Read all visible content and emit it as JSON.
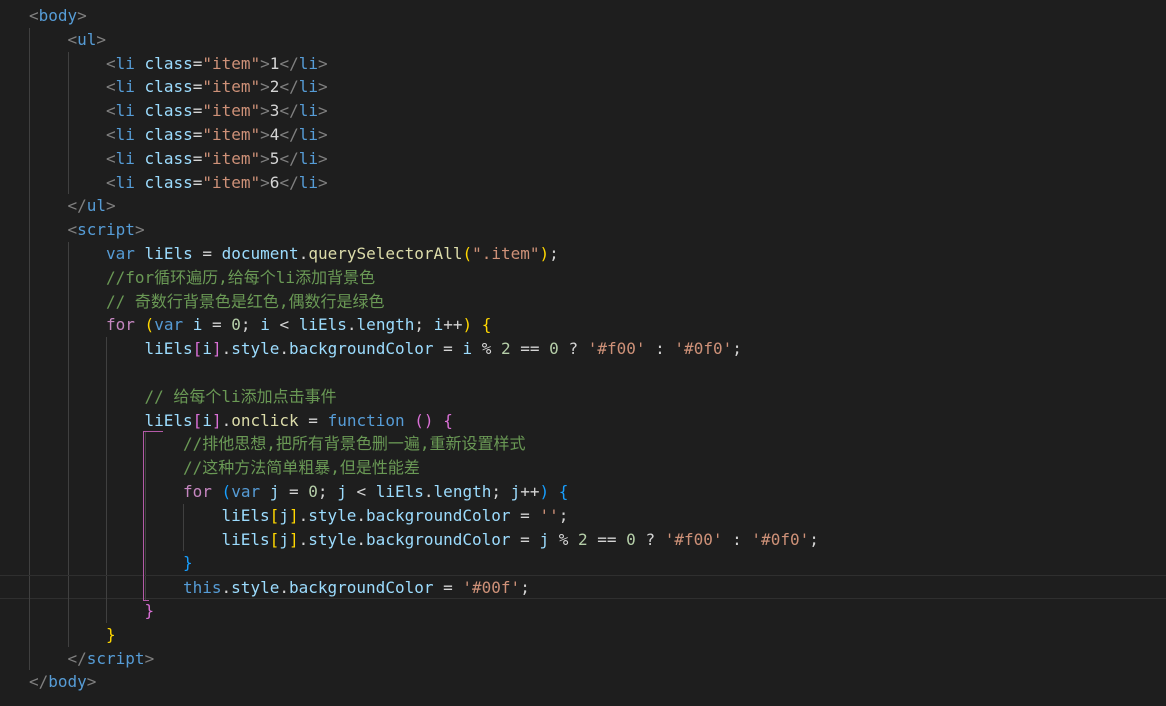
{
  "theme": {
    "background": "#1e1e1e",
    "colors": {
      "punct": "#808080",
      "tag": "#569cd6",
      "attr": "#9cdcfe",
      "string": "#ce9178",
      "text": "#d4d4d4",
      "keyword": "#569cd6",
      "control": "#c586c0",
      "variable": "#9cdcfe",
      "method": "#dcdcaa",
      "comment": "#6a9955",
      "number": "#b5cea8",
      "operator": "#d4d4d4",
      "bracket1": "#ffd700",
      "bracket2": "#da70d6",
      "bracket3": "#179fff"
    }
  },
  "code": {
    "current_line": 24,
    "lines": [
      {
        "indent": 0,
        "tokens": [
          [
            "<",
            "punct"
          ],
          [
            "body",
            "tag"
          ],
          [
            ">",
            "punct"
          ]
        ]
      },
      {
        "indent": 1,
        "tokens": [
          [
            "<",
            "punct"
          ],
          [
            "ul",
            "tag"
          ],
          [
            ">",
            "punct"
          ]
        ]
      },
      {
        "indent": 2,
        "tokens": [
          [
            "<",
            "punct"
          ],
          [
            "li",
            "tag"
          ],
          [
            " ",
            "text"
          ],
          [
            "class",
            "attr"
          ],
          [
            "=",
            "text"
          ],
          [
            "\"item\"",
            "string"
          ],
          [
            ">",
            "punct"
          ],
          [
            "1",
            "text"
          ],
          [
            "</",
            "punct"
          ],
          [
            "li",
            "tag"
          ],
          [
            ">",
            "punct"
          ]
        ]
      },
      {
        "indent": 2,
        "tokens": [
          [
            "<",
            "punct"
          ],
          [
            "li",
            "tag"
          ],
          [
            " ",
            "text"
          ],
          [
            "class",
            "attr"
          ],
          [
            "=",
            "text"
          ],
          [
            "\"item\"",
            "string"
          ],
          [
            ">",
            "punct"
          ],
          [
            "2",
            "text"
          ],
          [
            "</",
            "punct"
          ],
          [
            "li",
            "tag"
          ],
          [
            ">",
            "punct"
          ]
        ]
      },
      {
        "indent": 2,
        "tokens": [
          [
            "<",
            "punct"
          ],
          [
            "li",
            "tag"
          ],
          [
            " ",
            "text"
          ],
          [
            "class",
            "attr"
          ],
          [
            "=",
            "text"
          ],
          [
            "\"item\"",
            "string"
          ],
          [
            ">",
            "punct"
          ],
          [
            "3",
            "text"
          ],
          [
            "</",
            "punct"
          ],
          [
            "li",
            "tag"
          ],
          [
            ">",
            "punct"
          ]
        ]
      },
      {
        "indent": 2,
        "tokens": [
          [
            "<",
            "punct"
          ],
          [
            "li",
            "tag"
          ],
          [
            " ",
            "text"
          ],
          [
            "class",
            "attr"
          ],
          [
            "=",
            "text"
          ],
          [
            "\"item\"",
            "string"
          ],
          [
            ">",
            "punct"
          ],
          [
            "4",
            "text"
          ],
          [
            "</",
            "punct"
          ],
          [
            "li",
            "tag"
          ],
          [
            ">",
            "punct"
          ]
        ]
      },
      {
        "indent": 2,
        "tokens": [
          [
            "<",
            "punct"
          ],
          [
            "li",
            "tag"
          ],
          [
            " ",
            "text"
          ],
          [
            "class",
            "attr"
          ],
          [
            "=",
            "text"
          ],
          [
            "\"item\"",
            "string"
          ],
          [
            ">",
            "punct"
          ],
          [
            "5",
            "text"
          ],
          [
            "</",
            "punct"
          ],
          [
            "li",
            "tag"
          ],
          [
            ">",
            "punct"
          ]
        ]
      },
      {
        "indent": 2,
        "tokens": [
          [
            "<",
            "punct"
          ],
          [
            "li",
            "tag"
          ],
          [
            " ",
            "text"
          ],
          [
            "class",
            "attr"
          ],
          [
            "=",
            "text"
          ],
          [
            "\"item\"",
            "string"
          ],
          [
            ">",
            "punct"
          ],
          [
            "6",
            "text"
          ],
          [
            "</",
            "punct"
          ],
          [
            "li",
            "tag"
          ],
          [
            ">",
            "punct"
          ]
        ]
      },
      {
        "indent": 1,
        "tokens": [
          [
            "</",
            "punct"
          ],
          [
            "ul",
            "tag"
          ],
          [
            ">",
            "punct"
          ]
        ]
      },
      {
        "indent": 1,
        "tokens": [
          [
            "<",
            "punct"
          ],
          [
            "script",
            "tag"
          ],
          [
            ">",
            "punct"
          ]
        ]
      },
      {
        "indent": 2,
        "tokens": [
          [
            "var",
            "keyword"
          ],
          [
            " ",
            "text"
          ],
          [
            "liEls",
            "variable"
          ],
          [
            " = ",
            "operator"
          ],
          [
            "document",
            "variable"
          ],
          [
            ".",
            "text"
          ],
          [
            "querySelectorAll",
            "method"
          ],
          [
            "(",
            "bracket1"
          ],
          [
            "\".item\"",
            "string"
          ],
          [
            ")",
            "bracket1"
          ],
          [
            ";",
            "text"
          ]
        ]
      },
      {
        "indent": 2,
        "tokens": [
          [
            "//for循环遍历,给每个li添加背景色",
            "comment"
          ]
        ]
      },
      {
        "indent": 2,
        "tokens": [
          [
            "// 奇数行背景色是红色,偶数行是绿色",
            "comment"
          ]
        ]
      },
      {
        "indent": 2,
        "tokens": [
          [
            "for",
            "control"
          ],
          [
            " ",
            "text"
          ],
          [
            "(",
            "bracket1"
          ],
          [
            "var",
            "keyword"
          ],
          [
            " ",
            "text"
          ],
          [
            "i",
            "variable"
          ],
          [
            " = ",
            "operator"
          ],
          [
            "0",
            "number"
          ],
          [
            "; ",
            "text"
          ],
          [
            "i",
            "variable"
          ],
          [
            " < ",
            "operator"
          ],
          [
            "liEls",
            "variable"
          ],
          [
            ".",
            "text"
          ],
          [
            "length",
            "variable"
          ],
          [
            "; ",
            "text"
          ],
          [
            "i",
            "variable"
          ],
          [
            "++",
            "operator"
          ],
          [
            ")",
            "bracket1"
          ],
          [
            " ",
            "text"
          ],
          [
            "{",
            "bracket1"
          ]
        ]
      },
      {
        "indent": 3,
        "tokens": [
          [
            "liEls",
            "variable"
          ],
          [
            "[",
            "bracket2"
          ],
          [
            "i",
            "variable"
          ],
          [
            "]",
            "bracket2"
          ],
          [
            ".",
            "text"
          ],
          [
            "style",
            "variable"
          ],
          [
            ".",
            "text"
          ],
          [
            "backgroundColor",
            "variable"
          ],
          [
            " = ",
            "operator"
          ],
          [
            "i",
            "variable"
          ],
          [
            " % ",
            "operator"
          ],
          [
            "2",
            "number"
          ],
          [
            " == ",
            "operator"
          ],
          [
            "0",
            "number"
          ],
          [
            " ? ",
            "operator"
          ],
          [
            "'#f00'",
            "string"
          ],
          [
            " : ",
            "operator"
          ],
          [
            "'#0f0'",
            "string"
          ],
          [
            ";",
            "text"
          ]
        ]
      },
      {
        "indent": 3,
        "tokens": []
      },
      {
        "indent": 3,
        "tokens": [
          [
            "// 给每个li添加点击事件",
            "comment"
          ]
        ]
      },
      {
        "indent": 3,
        "tokens": [
          [
            "liEls",
            "variable"
          ],
          [
            "[",
            "bracket2"
          ],
          [
            "i",
            "variable"
          ],
          [
            "]",
            "bracket2"
          ],
          [
            ".",
            "text"
          ],
          [
            "onclick",
            "method"
          ],
          [
            " = ",
            "operator"
          ],
          [
            "function",
            "keyword"
          ],
          [
            " ",
            "text"
          ],
          [
            "()",
            "bracket2"
          ],
          [
            " ",
            "text"
          ],
          [
            "{",
            "bracket2"
          ]
        ]
      },
      {
        "indent": 4,
        "tokens": [
          [
            "//排他思想,把所有背景色删一遍,重新设置样式",
            "comment"
          ]
        ]
      },
      {
        "indent": 4,
        "tokens": [
          [
            "//这种方法简单粗暴,但是性能差",
            "comment"
          ]
        ]
      },
      {
        "indent": 4,
        "tokens": [
          [
            "for",
            "control"
          ],
          [
            " ",
            "text"
          ],
          [
            "(",
            "bracket3"
          ],
          [
            "var",
            "keyword"
          ],
          [
            " ",
            "text"
          ],
          [
            "j",
            "variable"
          ],
          [
            " = ",
            "operator"
          ],
          [
            "0",
            "number"
          ],
          [
            "; ",
            "text"
          ],
          [
            "j",
            "variable"
          ],
          [
            " < ",
            "operator"
          ],
          [
            "liEls",
            "variable"
          ],
          [
            ".",
            "text"
          ],
          [
            "length",
            "variable"
          ],
          [
            "; ",
            "text"
          ],
          [
            "j",
            "variable"
          ],
          [
            "++",
            "operator"
          ],
          [
            ")",
            "bracket3"
          ],
          [
            " ",
            "text"
          ],
          [
            "{",
            "bracket3"
          ]
        ]
      },
      {
        "indent": 5,
        "tokens": [
          [
            "liEls",
            "variable"
          ],
          [
            "[",
            "bracket1"
          ],
          [
            "j",
            "variable"
          ],
          [
            "]",
            "bracket1"
          ],
          [
            ".",
            "text"
          ],
          [
            "style",
            "variable"
          ],
          [
            ".",
            "text"
          ],
          [
            "backgroundColor",
            "variable"
          ],
          [
            " = ",
            "operator"
          ],
          [
            "''",
            "string"
          ],
          [
            ";",
            "text"
          ]
        ]
      },
      {
        "indent": 5,
        "tokens": [
          [
            "liEls",
            "variable"
          ],
          [
            "[",
            "bracket1"
          ],
          [
            "j",
            "variable"
          ],
          [
            "]",
            "bracket1"
          ],
          [
            ".",
            "text"
          ],
          [
            "style",
            "variable"
          ],
          [
            ".",
            "text"
          ],
          [
            "backgroundColor",
            "variable"
          ],
          [
            " = ",
            "operator"
          ],
          [
            "j",
            "variable"
          ],
          [
            " % ",
            "operator"
          ],
          [
            "2",
            "number"
          ],
          [
            " == ",
            "operator"
          ],
          [
            "0",
            "number"
          ],
          [
            " ? ",
            "operator"
          ],
          [
            "'#f00'",
            "string"
          ],
          [
            " : ",
            "operator"
          ],
          [
            "'#0f0'",
            "string"
          ],
          [
            ";",
            "text"
          ]
        ]
      },
      {
        "indent": 4,
        "tokens": [
          [
            "}",
            "bracket3"
          ]
        ]
      },
      {
        "indent": 4,
        "tokens": [
          [
            "this",
            "keyword"
          ],
          [
            ".",
            "text"
          ],
          [
            "style",
            "variable"
          ],
          [
            ".",
            "text"
          ],
          [
            "backgroundColor",
            "variable"
          ],
          [
            " = ",
            "operator"
          ],
          [
            "'#00f'",
            "string"
          ],
          [
            ";",
            "text"
          ]
        ]
      },
      {
        "indent": 3,
        "tokens": [
          [
            "}",
            "bracket2"
          ]
        ]
      },
      {
        "indent": 2,
        "tokens": [
          [
            "}",
            "bracket1"
          ]
        ]
      },
      {
        "indent": 1,
        "tokens": [
          [
            "</",
            "punct"
          ],
          [
            "script",
            "tag"
          ],
          [
            ">",
            "punct"
          ]
        ]
      },
      {
        "indent": 0,
        "tokens": [
          [
            "</",
            "punct"
          ],
          [
            "body",
            "tag"
          ],
          [
            ">",
            "punct"
          ]
        ]
      }
    ]
  }
}
